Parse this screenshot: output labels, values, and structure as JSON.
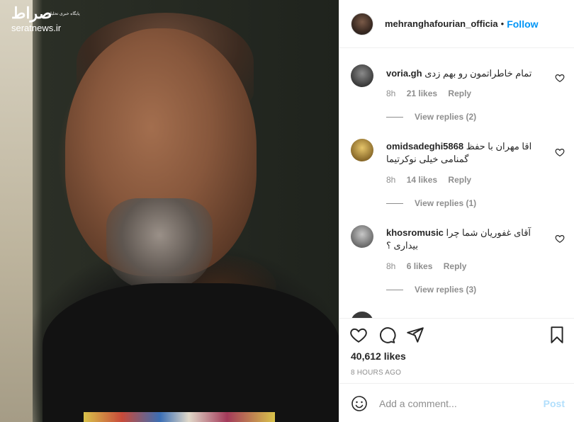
{
  "watermark": {
    "logo": "صراط",
    "tagline": "پایگاه خبری تحلیلی",
    "site": "seratnews.ir"
  },
  "post": {
    "username": "mehranghafourian_officia",
    "separator": "•",
    "follow_label": "Follow",
    "likes": "40,612 likes",
    "time": "8 HOURS AGO"
  },
  "comments": [
    {
      "username": "voria.gh",
      "text": "تمام خاطراتمون رو بهم زدی",
      "time": "8h",
      "likes": "21 likes",
      "reply_label": "Reply",
      "view_replies": "View replies (2)",
      "avatar_color": "#4a4a4a"
    },
    {
      "username": "omidsadeghi5868",
      "text": "اقا مهران با حفظ گمنامی خیلی نوکرتیما",
      "time": "8h",
      "likes": "14 likes",
      "reply_label": "Reply",
      "view_replies": "View replies (1)",
      "avatar_color": "#b58a3a"
    },
    {
      "username": "khosromusic",
      "text": "آقای غفوریان شما چرا بیداری ؟",
      "time": "8h",
      "likes": "6 likes",
      "reply_label": "Reply",
      "view_replies": "View replies (3)",
      "avatar_color": "#8a8a8a"
    }
  ],
  "composer": {
    "placeholder": "Add a comment...",
    "post_label": "Post"
  },
  "colors": {
    "link": "#0095f6",
    "muted": "#8e8e8e",
    "post_disabled": "#b2dffc"
  },
  "icons": [
    "heart-icon",
    "comment-icon",
    "share-icon",
    "bookmark-icon",
    "emoji-icon",
    "comment-like-icon"
  ]
}
